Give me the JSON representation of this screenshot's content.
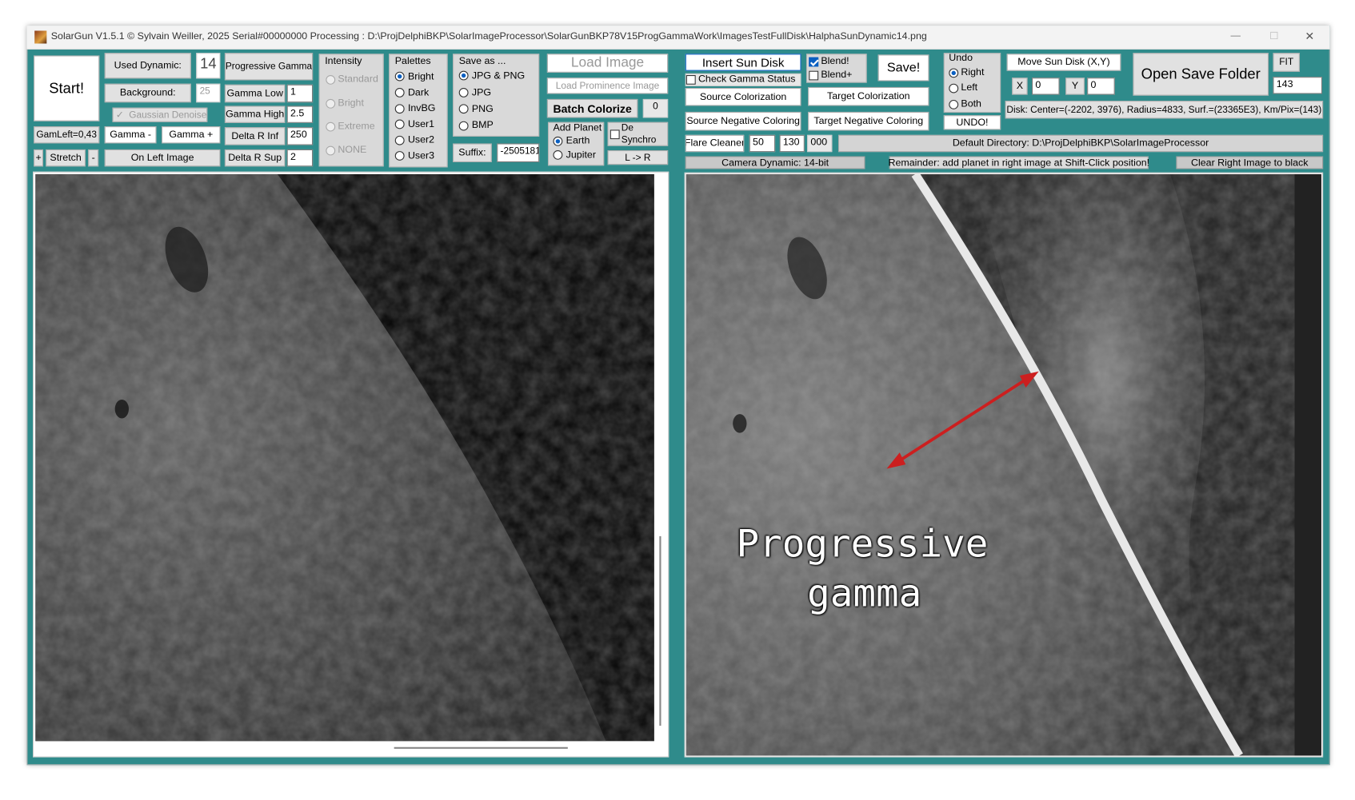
{
  "window": {
    "title": "SolarGun V1.5.1 © Sylvain Weiller, 2025 Serial#00000000   Processing : D:\\ProjDelphiBKP\\SolarImageProcessor\\SolarGunBKP78V15ProgGammaWork\\ImagesTestFullDisk\\HalphaSunDynamic14.png",
    "minimize": "—",
    "maximize": "☐",
    "close": "✕"
  },
  "left_controls": {
    "start": "Start!",
    "used_dynamic": "Used Dynamic:",
    "used_dynamic_value": "14",
    "progressive_gamma": "Progressive Gamma",
    "background": "Background:",
    "background_value": "25",
    "gamma_low": "Gamma Low",
    "gamma_low_value": "1",
    "gaussian_denoise": "Gaussian Denoise",
    "gamma_high": "Gamma High",
    "gamma_high_value": "2.5",
    "gam_left": "GamLeft=0,43",
    "gamma_minus": "Gamma -",
    "gamma_plus": "Gamma +",
    "delta_r_inf": "Delta R Inf",
    "delta_r_inf_value": "250",
    "plus": "+",
    "stretch": "Stretch",
    "minus": "-",
    "on_left_image": "On Left Image",
    "delta_r_sup": "Delta R Sup",
    "delta_r_sup_value": "2"
  },
  "intensity": {
    "title": "Intensity",
    "options": [
      "Standard",
      "Bright",
      "Extreme",
      "NONE"
    ]
  },
  "palettes": {
    "title": "Palettes",
    "options": [
      "Bright",
      "Dark",
      "InvBG",
      "User1",
      "User2",
      "User3"
    ],
    "selected": "Bright"
  },
  "save_as": {
    "title": "Save as ...",
    "options": [
      "JPG & PNG",
      "JPG",
      "PNG",
      "BMP"
    ],
    "selected": "JPG & PNG",
    "suffix_label": "Suffix:",
    "suffix_value": "-2505181"
  },
  "load": {
    "load_image": "Load Image",
    "load_prominence": "Load Prominence Image",
    "batch_colorize": "Batch Colorize",
    "batch_count": "0",
    "add_planet": "Add Planet",
    "earth": "Earth",
    "jupiter": "Jupiter",
    "de_synchro_1": "De",
    "de_synchro_2": "Synchro",
    "l_to_r": "L -> R"
  },
  "right_controls": {
    "insert_sun_disk": "Insert Sun Disk",
    "check_gamma_status": "Check Gamma Status",
    "blend": "Blend!",
    "blend_plus": "Blend+",
    "save": "Save!",
    "source_colorization": "Source Colorization",
    "target_colorization": "Target Colorization",
    "source_negative_coloring": "Source Negative Coloring",
    "target_negative_coloring": "Target Negative Coloring",
    "flare_cleaner": "Flare Cleaner",
    "flare_a": "50",
    "flare_b": "130",
    "flare_c": "000",
    "undo_title": "Undo",
    "undo_options": [
      "Right",
      "Left",
      "Both"
    ],
    "undo_selected": "Right",
    "undo_button": "UNDO!",
    "move_sun_disk": "Move Sun Disk (X,Y)",
    "x_label": "X",
    "x_value": "0",
    "y_label": "Y",
    "y_value": "0",
    "open_save_folder": "Open Save Folder",
    "fit": "FIT",
    "fit_value": "143",
    "disk_info": "Disk: Center=(-2202, 3976), Radius=4833, Surf.=(23365E3), Km/Pix=(143)",
    "default_directory": "Default Directory: D:\\ProjDelphiBKP\\SolarImageProcessor"
  },
  "status": {
    "camera_dynamic": "Camera Dynamic: 14-bit",
    "remainder": "Remainder: add planet in right image at Shift-Click position!",
    "clear_right": "Clear Right Image to black"
  },
  "annotation": {
    "line1": "Progressive",
    "line2": "gamma",
    "arrow_color": "#cc1f1f"
  },
  "colors": {
    "window_bg": "#2f8b8b",
    "accent": "#0a5fc1"
  }
}
